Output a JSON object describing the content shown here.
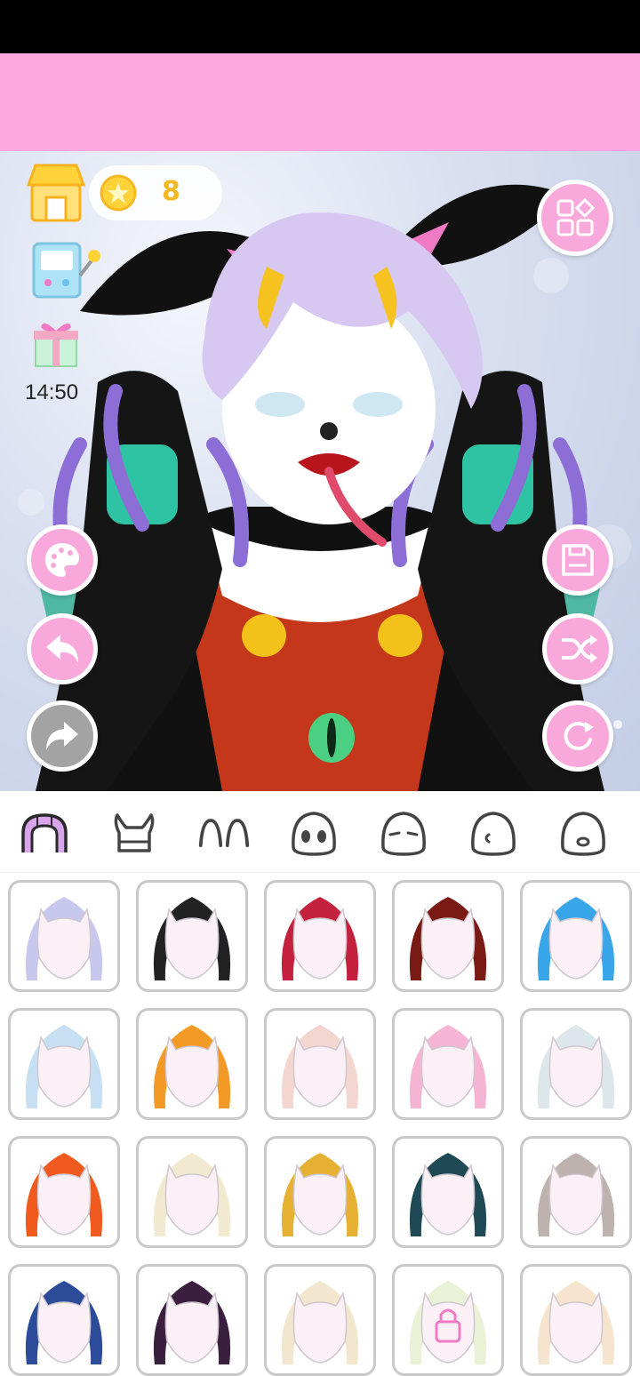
{
  "status_bar": {},
  "hud": {
    "coins": "8",
    "time": "14:50"
  },
  "icons": {
    "shop": "shop-icon",
    "coin": "coin-icon",
    "game": "game-machine-icon",
    "gift": "gift-icon",
    "grid": "grid-menu-icon",
    "palette": "palette-icon",
    "undo": "undo-icon",
    "redo": "redo-icon",
    "save": "save-icon",
    "shuffle": "shuffle-icon",
    "reset": "reset-icon"
  },
  "categories": [
    {
      "name": "hair",
      "selected": true
    },
    {
      "name": "horns"
    },
    {
      "name": "ears"
    },
    {
      "name": "eyes"
    },
    {
      "name": "brows"
    },
    {
      "name": "nose"
    },
    {
      "name": "mouth"
    }
  ],
  "items": [
    {
      "color": "#c8c8ee",
      "locked": false
    },
    {
      "color": "#222222",
      "locked": false
    },
    {
      "color": "#c3213e",
      "locked": false
    },
    {
      "color": "#7a1a14",
      "locked": false
    },
    {
      "color": "#3aa6ea",
      "locked": false
    },
    {
      "color": "#c7dff2",
      "locked": false
    },
    {
      "color": "#f39a26",
      "locked": false
    },
    {
      "color": "#f3d6cf",
      "locked": false
    },
    {
      "color": "#f5b4d3",
      "locked": false
    },
    {
      "color": "#dde6ea",
      "locked": false
    },
    {
      "color": "#f05a1e",
      "locked": false
    },
    {
      "color": "#f1ead1",
      "locked": false
    },
    {
      "color": "#e6b033",
      "locked": false
    },
    {
      "color": "#1f4a55",
      "locked": false
    },
    {
      "color": "#bdb2ae",
      "locked": false
    },
    {
      "color": "#2c4c9a",
      "locked": false
    },
    {
      "color": "#3a1f3f",
      "locked": false
    },
    {
      "color": "#f2e6cf",
      "locked": false
    },
    {
      "color": "#e9f1d6",
      "locked": true
    },
    {
      "color": "#f6e4cf",
      "locked": false
    }
  ],
  "colors": {
    "banner": "#fea8e1",
    "accent_pink": "#f9a8dc",
    "disabled_grey": "#a3a3a3",
    "coin_text": "#f5b823"
  }
}
